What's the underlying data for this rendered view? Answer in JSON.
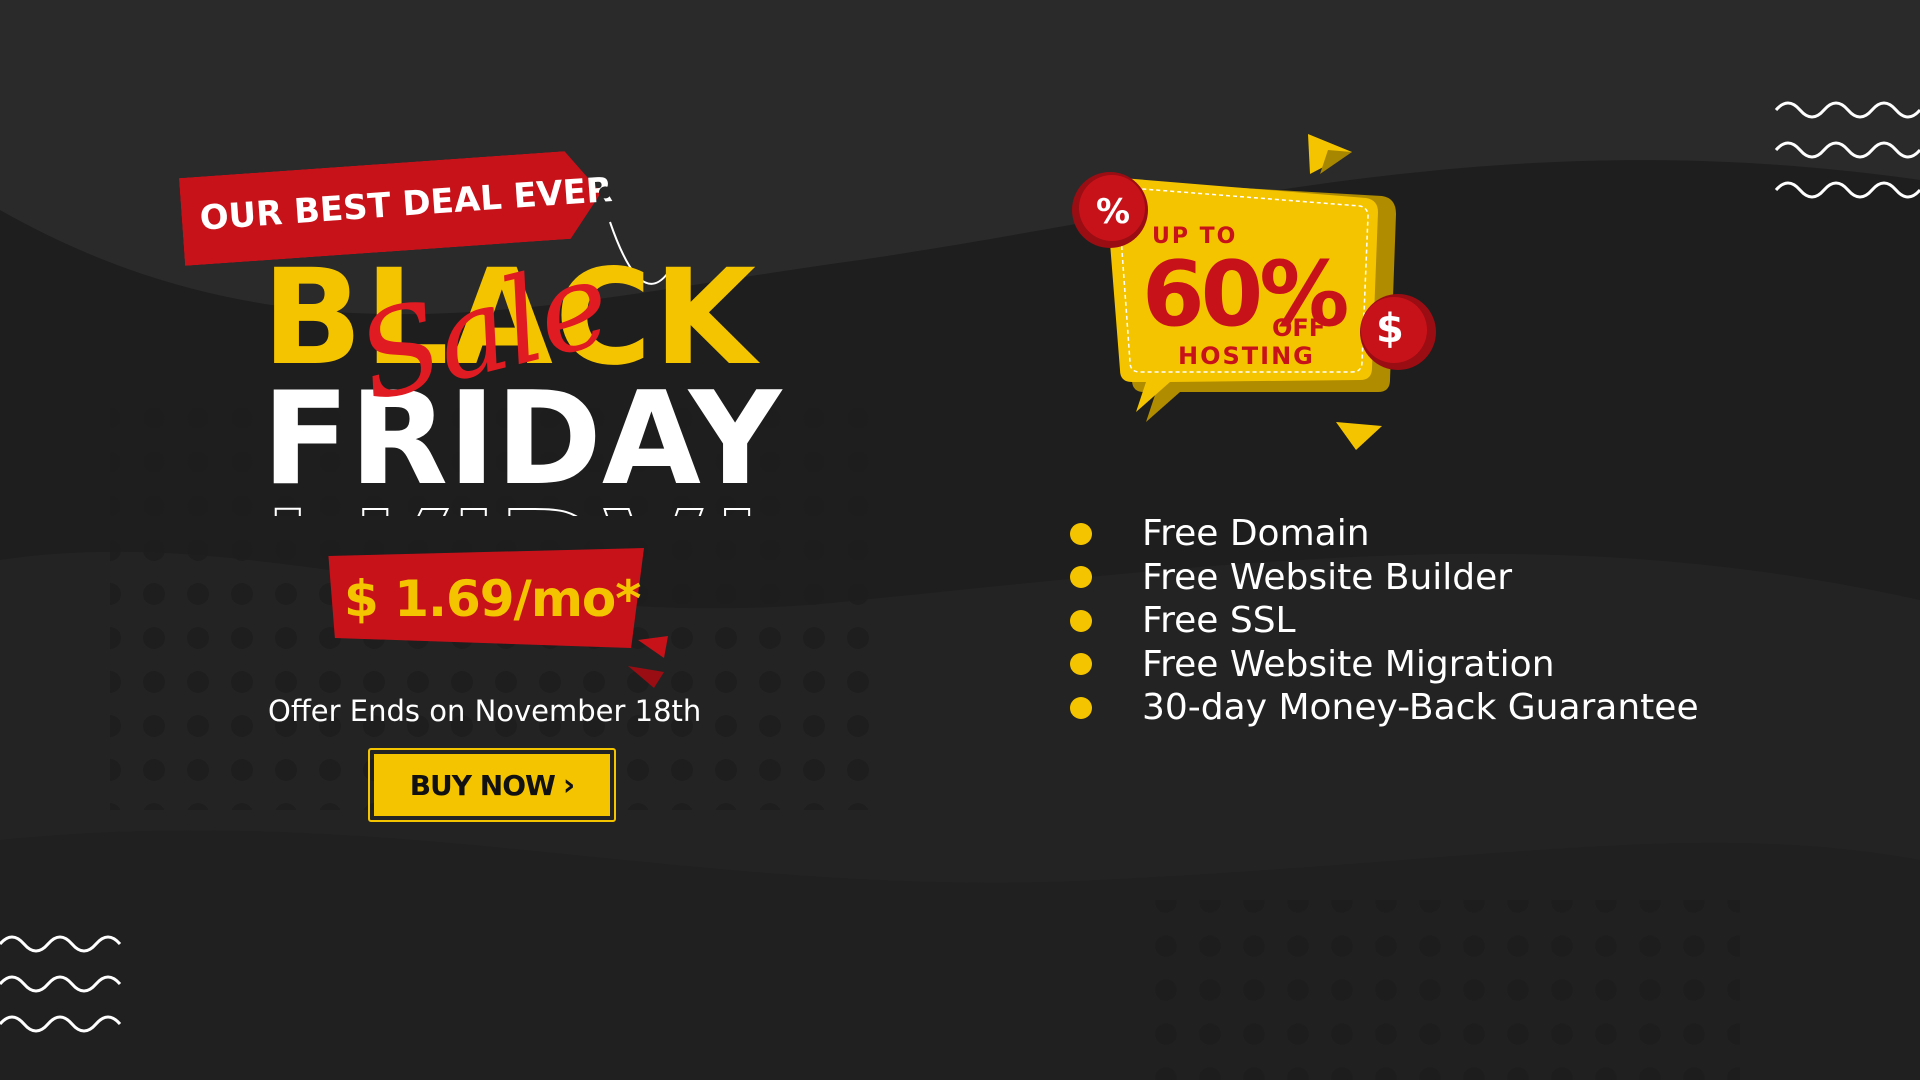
{
  "banner": {
    "deal_tag": "OUR BEST DEAL EVER",
    "title_line1": "BLACK",
    "title_line2": "FRIDAY",
    "script_word": "Sale",
    "price": "$ 1.69/mo*",
    "offer_ends": "Offer Ends on November 18th",
    "buy_button": "BUY NOW",
    "buy_chevron": "›"
  },
  "promo_bubble": {
    "up_to": "UP TO",
    "percent": "60%",
    "off": "OFF",
    "product": "HOSTING",
    "percent_badge": "%",
    "dollar_badge": "$"
  },
  "features": [
    "Free Domain",
    "Free Website Builder",
    "Free SSL",
    "Free Website Migration",
    "30-day Money-Back Guarantee"
  ],
  "colors": {
    "background": "#262626",
    "accent_yellow": "#f5c400",
    "accent_red": "#c8121a",
    "text_white": "#ffffff"
  },
  "icons": [
    "wave-lines-icon",
    "percent-badge-icon",
    "dollar-badge-icon",
    "chevron-right-icon",
    "bullet-dot-icon"
  ]
}
